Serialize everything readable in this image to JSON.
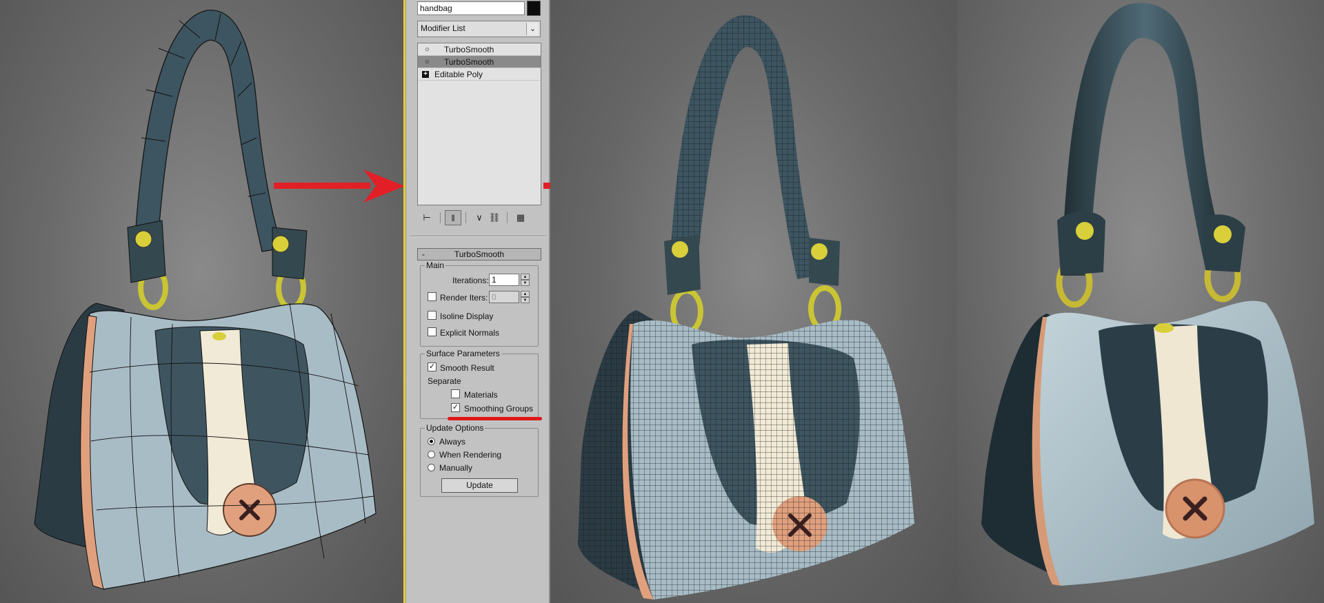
{
  "panel": {
    "object_name": "handbag",
    "object_color": "#0c0c0c",
    "modifier_list_label": "Modifier List",
    "stack": [
      {
        "label": "TurboSmooth",
        "selected": false,
        "icon": "lightbulb-icon"
      },
      {
        "label": "TurboSmooth",
        "selected": true,
        "icon": "lightbulb-icon"
      },
      {
        "label": "Editable Poly",
        "selected": false,
        "icon": "expand-plus-icon"
      }
    ],
    "toolbar_icons": [
      "pin-stack-icon",
      "show-end-result-icon",
      "make-unique-icon",
      "remove-modifier-icon",
      "configure-modifier-sets-icon"
    ],
    "rollout_title": "TurboSmooth",
    "main_group": {
      "title": "Main",
      "iterations_label": "Iterations:",
      "iterations_value": "1",
      "render_iters_label": "Render Iters:",
      "render_iters_value": "0",
      "render_iters_checked": false,
      "isoline_label": "Isoline Display",
      "isoline_checked": false,
      "explicit_normals_label": "Explicit Normals",
      "explicit_normals_checked": false
    },
    "surface_group": {
      "title": "Surface Parameters",
      "smooth_result_label": "Smooth Result",
      "smooth_result_checked": true,
      "separate_label": "Separate",
      "materials_label": "Materials",
      "materials_checked": false,
      "smoothing_groups_label": "Smoothing Groups",
      "smoothing_groups_checked": true
    },
    "update_group": {
      "title": "Update Options",
      "options": [
        "Always",
        "When Rendering",
        "Manually"
      ],
      "selected": "Always",
      "update_button": "Update"
    }
  },
  "colors": {
    "accent_arrow": "#e21f26",
    "highlight_underline": "#e01616",
    "viewport_frame": "#e8cf2a",
    "bag_body": "#a8bcc6",
    "bag_dark": "#2b3b44",
    "strap_cream": "#f1ead6",
    "button_peach": "#e0a07e",
    "rivet_yellow": "#d8cf3a"
  }
}
